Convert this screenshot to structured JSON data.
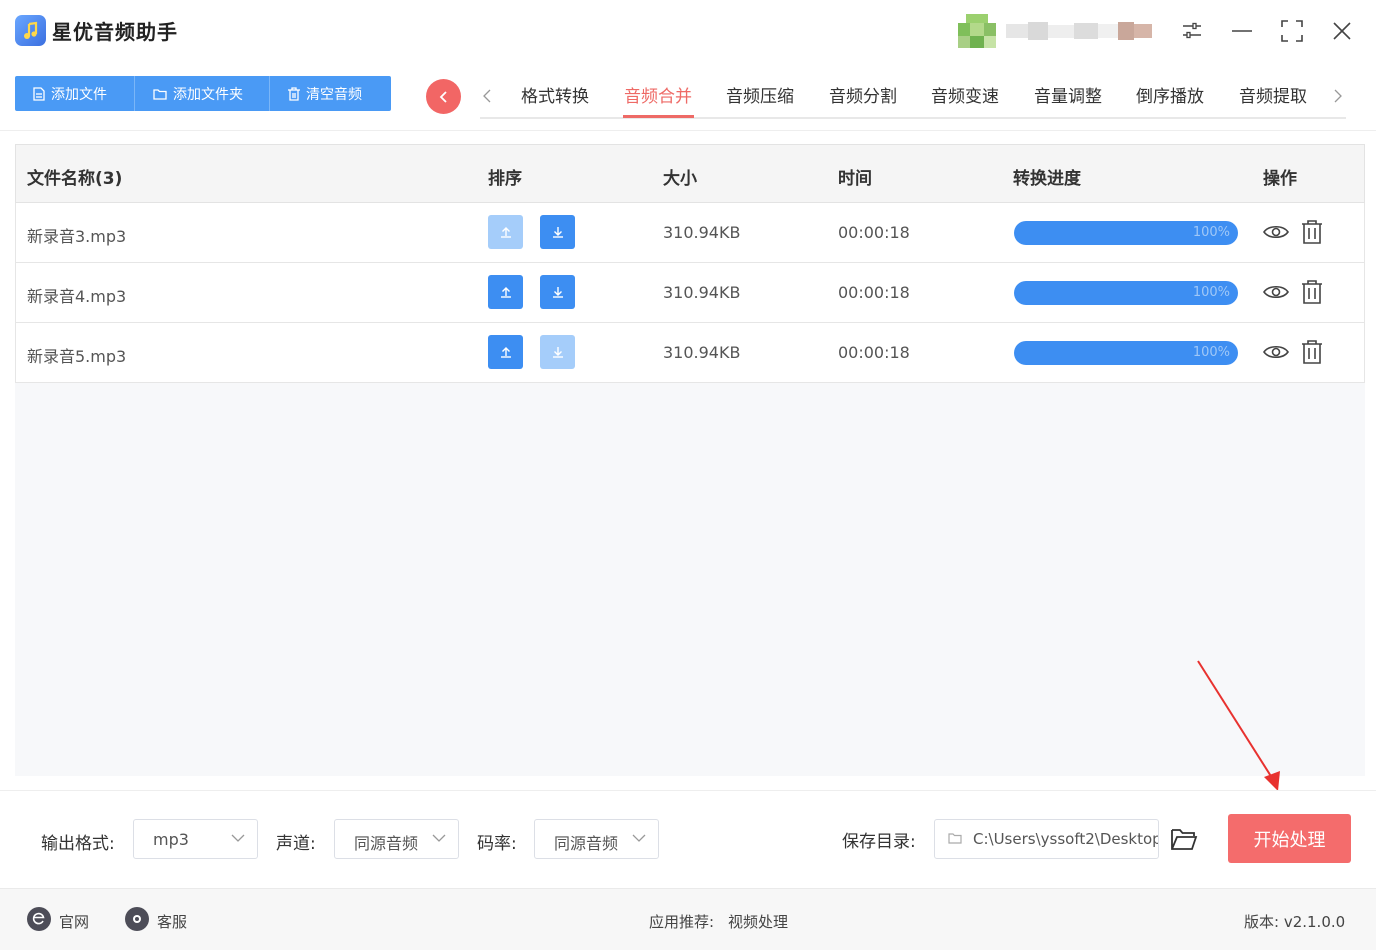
{
  "app": {
    "title": "星优音频助手"
  },
  "toolbar": {
    "add_file": "添加文件",
    "add_folder": "添加文件夹",
    "clear_audio": "清空音频"
  },
  "tabs": [
    {
      "label": "格式转换"
    },
    {
      "label": "音频合并"
    },
    {
      "label": "音频压缩"
    },
    {
      "label": "音频分割"
    },
    {
      "label": "音频变速"
    },
    {
      "label": "音量调整"
    },
    {
      "label": "倒序播放"
    },
    {
      "label": "音频提取"
    }
  ],
  "active_tab": "音频合并",
  "table": {
    "headers": {
      "name": "文件名称(3)",
      "sort": "排序",
      "size": "大小",
      "time": "时间",
      "progress": "转换进度",
      "action": "操作"
    },
    "rows": [
      {
        "name": "新录音3.mp3",
        "size": "310.94KB",
        "time": "00:00:18",
        "progress": "100%",
        "progress_value": 100,
        "up_enabled": false,
        "down_enabled": true
      },
      {
        "name": "新录音4.mp3",
        "size": "310.94KB",
        "time": "00:00:18",
        "progress": "100%",
        "progress_value": 100,
        "up_enabled": true,
        "down_enabled": true
      },
      {
        "name": "新录音5.mp3",
        "size": "310.94KB",
        "time": "00:00:18",
        "progress": "100%",
        "progress_value": 100,
        "up_enabled": true,
        "down_enabled": false
      }
    ]
  },
  "settings": {
    "format_label": "输出格式:",
    "format_value": "mp3",
    "channel_label": "声道:",
    "channel_value": "同源音频",
    "bitrate_label": "码率:",
    "bitrate_value": "同源音频",
    "save_dir_label": "保存目录:",
    "save_dir_value": "C:\\Users\\yssoft2\\Desktop",
    "start_button": "开始处理"
  },
  "footer": {
    "website": "官网",
    "service": "客服",
    "recommend_label": "应用推荐:",
    "recommend_value": "视频处理",
    "version": "版本: v2.1.0.0"
  },
  "colors": {
    "accent_blue": "#3d8ef2",
    "accent_red": "#f46c6c",
    "active_tab": "#ee6a66"
  }
}
